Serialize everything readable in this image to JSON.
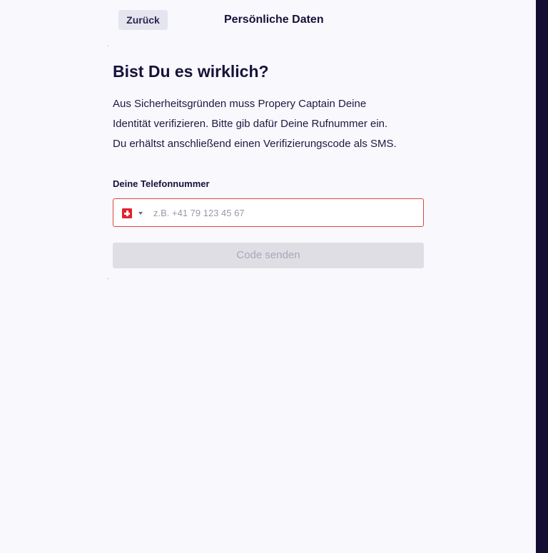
{
  "header": {
    "back_label": "Zurück",
    "title": "Persönliche Daten"
  },
  "main": {
    "heading": "Bist Du es wirklich?",
    "intro_lines": [
      "Aus Sicherheitsgründen muss Propery Captain Deine",
      "Identität verifizieren. Bitte gib dafür Deine Rufnummer ein.",
      "Du erhältst anschließend einen Verifizierungscode als SMS."
    ],
    "phone_label": "Deine Telefonnummer",
    "phone_field": {
      "country_icon": "swiss-flag-icon",
      "value": "",
      "placeholder": "z.B. +41 79 123 45 67",
      "border_color": "#d9473f"
    },
    "send_label": "Code senden",
    "send_disabled": true
  },
  "colors": {
    "background": "#f8f8fd",
    "text": "#16123a",
    "sidebar_strip": "#150d33",
    "back_button_bg": "#e5e5f0",
    "disabled_button_bg": "#dedee4",
    "disabled_button_text": "#a9a8b6",
    "error_border": "#d9473f"
  }
}
